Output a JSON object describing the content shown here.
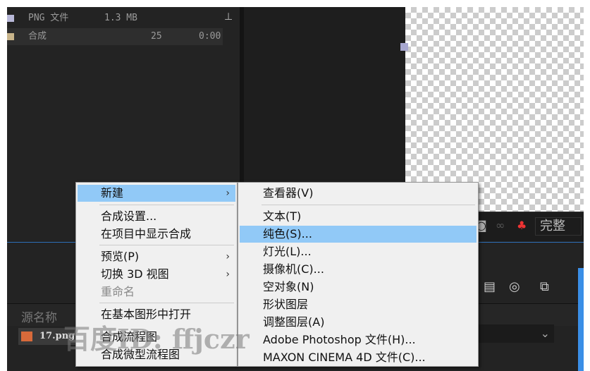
{
  "project": {
    "items": [
      {
        "name": "PNG 文件",
        "size": "1.3 MB",
        "color": "#b8b8d8"
      },
      {
        "name": "合成",
        "fps": "25",
        "duration": "0:00",
        "color": "#c8b48a"
      }
    ]
  },
  "viewer": {
    "resolution": "完整"
  },
  "timeline": {
    "column_source_name": "源名称",
    "layer_name": "17.png"
  },
  "watermark": "百度ID: ffjczr",
  "context_menu": {
    "items": [
      {
        "label": "新建",
        "submenu": true,
        "highlighted": true
      },
      {
        "label": "合成设置..."
      },
      {
        "label": "在项目中显示合成"
      },
      {
        "label": "预览(P)",
        "submenu": true
      },
      {
        "label": "切换 3D 视图",
        "submenu": true
      },
      {
        "label": "重命名",
        "disabled": true
      },
      {
        "label": "在基本图形中打开"
      },
      {
        "label": "合成流程图"
      },
      {
        "label": "合成微型流程图"
      }
    ]
  },
  "submenu": {
    "items": [
      {
        "label": "查看器(V)"
      },
      {
        "label": "文本(T)"
      },
      {
        "label": "纯色(S)...",
        "highlighted": true
      },
      {
        "label": "灯光(L)..."
      },
      {
        "label": "摄像机(C)..."
      },
      {
        "label": "空对象(N)"
      },
      {
        "label": "形状图层"
      },
      {
        "label": "调整图层(A)"
      },
      {
        "label": "Adobe Photoshop 文件(H)..."
      },
      {
        "label": "MAXON CINEMA 4D 文件(C)..."
      }
    ]
  }
}
